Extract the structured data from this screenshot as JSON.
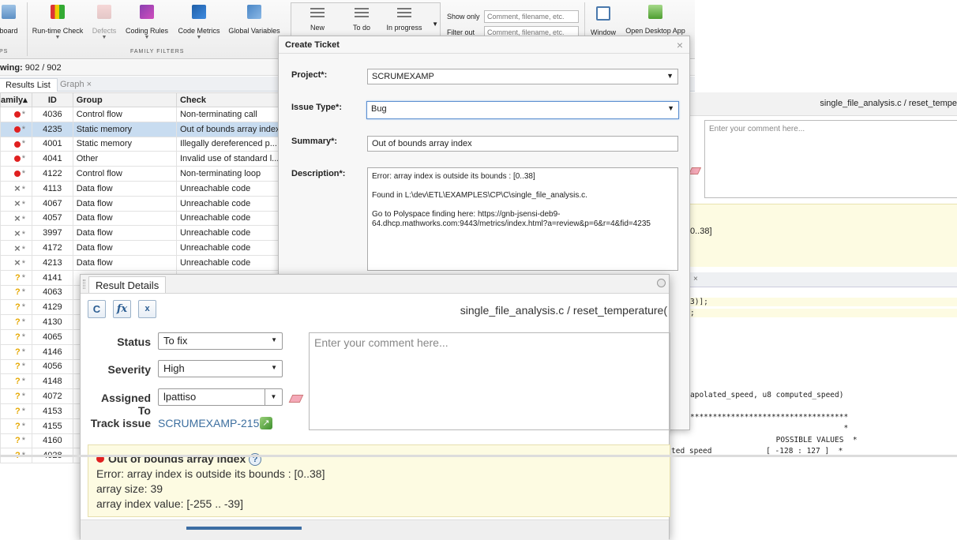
{
  "toolstrip": {
    "buttons": [
      {
        "label": "board",
        "icon": "dashboard-icon"
      },
      {
        "label": "Run-time Check",
        "icon": "bar-chart-icon"
      },
      {
        "label": "Defects",
        "icon": "defects-icon",
        "disabled": true
      },
      {
        "label": "Coding Rules",
        "icon": "coding-rules-icon"
      },
      {
        "label": "Code Metrics",
        "icon": "code-metrics-icon"
      },
      {
        "label": "Global Variables",
        "icon": "global-variables-icon"
      }
    ],
    "section_left": "PS",
    "section_family": "FAMILY FILTERS",
    "status_filters": [
      {
        "label": "New"
      },
      {
        "label": "To do"
      },
      {
        "label": "In progress"
      }
    ],
    "show_only_label": "Show only",
    "show_only_placeholder": "Comment, filename, etc.",
    "filter_out_label": "Filter out",
    "filter_out_placeholder": "Comment, filename, etc.",
    "window_label": "Window",
    "open_desktop_label": "Open Desktop App",
    "colors": {
      "accent": "#3c6da3",
      "selected_row": "#c8dcf0",
      "info_bg": "#fdfbe2",
      "red": "#e02020",
      "orange": "#e6a800"
    }
  },
  "results": {
    "showing_label": "wing:",
    "showing_value": "902 / 902",
    "tabs": [
      {
        "label": "Results List"
      },
      {
        "label": "Graph ×"
      }
    ],
    "columns": [
      "amily▴",
      "ID",
      "Group",
      "Check"
    ],
    "rows": [
      {
        "marker": "dot",
        "id": "4036",
        "group": "Control flow",
        "check": "Non-terminating call"
      },
      {
        "marker": "dot",
        "id": "4235",
        "group": "Static memory",
        "check": "Out of bounds array index",
        "selected": true
      },
      {
        "marker": "dot",
        "id": "4001",
        "group": "Static memory",
        "check": "Illegally dereferenced p..."
      },
      {
        "marker": "dot",
        "id": "4041",
        "group": "Other",
        "check": "Invalid use of standard l..."
      },
      {
        "marker": "dot",
        "id": "4122",
        "group": "Control flow",
        "check": "Non-terminating loop"
      },
      {
        "marker": "x",
        "id": "4113",
        "group": "Data flow",
        "check": "Unreachable code"
      },
      {
        "marker": "x",
        "id": "4067",
        "group": "Data flow",
        "check": "Unreachable code"
      },
      {
        "marker": "x",
        "id": "4057",
        "group": "Data flow",
        "check": "Unreachable code"
      },
      {
        "marker": "x",
        "id": "3997",
        "group": "Data flow",
        "check": "Unreachable code"
      },
      {
        "marker": "x",
        "id": "4172",
        "group": "Data flow",
        "check": "Unreachable code"
      },
      {
        "marker": "x",
        "id": "4213",
        "group": "Data flow",
        "check": "Unreachable code"
      },
      {
        "marker": "q",
        "id": "4141",
        "group": "",
        "check": ""
      },
      {
        "marker": "q",
        "id": "4063",
        "group": "",
        "check": ""
      },
      {
        "marker": "q",
        "id": "4129",
        "group": "",
        "check": ""
      },
      {
        "marker": "q",
        "id": "4130",
        "group": "",
        "check": ""
      },
      {
        "marker": "q",
        "id": "4065",
        "group": "",
        "check": ""
      },
      {
        "marker": "q",
        "id": "4146",
        "group": "",
        "check": ""
      },
      {
        "marker": "q",
        "id": "4056",
        "group": "",
        "check": ""
      },
      {
        "marker": "q",
        "id": "4148",
        "group": "",
        "check": ""
      },
      {
        "marker": "q",
        "id": "4072",
        "group": "",
        "check": ""
      },
      {
        "marker": "q",
        "id": "4153",
        "group": "",
        "check": ""
      },
      {
        "marker": "q",
        "id": "4155",
        "group": "",
        "check": ""
      },
      {
        "marker": "q",
        "id": "4160",
        "group": "",
        "check": ""
      },
      {
        "marker": "q",
        "id": "4028",
        "group": "",
        "check": ""
      }
    ]
  },
  "right_panel": {
    "file_title": "single_file_analysis.c / reset_tempe",
    "comment_placeholder": "Enter your comment here...",
    "yellow_text": "0..38]",
    "code_lines": [
      "3)];",
      ";",
      "apolated_speed, u8 computed_speed)",
      "***********************************",
      "                                  *",
      "                   POSSIBLE VALUES  *",
      "ted_speed            [ -128 : 127 ]  *"
    ]
  },
  "ticket": {
    "title": "Create Ticket",
    "close": "×",
    "project_label": "Project*:",
    "project_value": "SCRUMEXAMP",
    "issue_type_label": "Issue Type*:",
    "issue_type_value": "Bug",
    "summary_label": "Summary*:",
    "summary_value": "Out of bounds array index",
    "description_label": "Description*:",
    "description_lines": [
      "Error: array index is outside its bounds : [0..38]",
      "Found in L:\\dev\\ETL\\EXAMPLES\\CP\\C\\single_file_analysis.c.",
      "Go to Polyspace finding here: https://gnb-jsensi-deb9-64.dhcp.mathworks.com:9443/metrics/index.html?a=review&p=6&r=4&fid=4235"
    ]
  },
  "details": {
    "tab_title": "Result Details",
    "file_title": "single_file_analysis.c / reset_temperature(",
    "status_label": "Status",
    "status_value": "To fix",
    "severity_label": "Severity",
    "severity_value": "High",
    "assigned_label": "Assigned To",
    "assigned_value": "lpattiso",
    "track_label": "Track issue",
    "track_value": "SCRUMEXAMP-215",
    "comment_placeholder": "Enter your comment here...",
    "finding_title": "Out of bounds array index",
    "finding_help": "?",
    "finding_lines": [
      "Error: array index is outside its bounds : [0..38]",
      "array size: 39",
      "array index value: [-255 .. -39]"
    ]
  }
}
